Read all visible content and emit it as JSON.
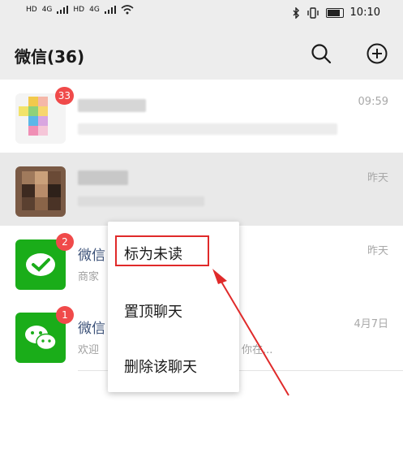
{
  "status_bar": {
    "left_icons": [
      "HD",
      "4G",
      "HD",
      "4G",
      "wifi-icon"
    ],
    "right_icons": [
      "bluetooth-icon",
      "vibrate-icon",
      "battery-icon"
    ],
    "time": "10:10"
  },
  "header": {
    "title": "微信(36)",
    "search_icon": "search-icon",
    "add_icon": "plus-circle-icon"
  },
  "chats": [
    {
      "name": "",
      "preview": "",
      "time": "09:59",
      "badge": "33"
    },
    {
      "name": "",
      "preview": "",
      "time": "昨天",
      "badge": ""
    },
    {
      "name": "微信",
      "preview": "商家",
      "time": "昨天",
      "badge": "2"
    },
    {
      "name": "微信",
      "preview": "欢迎",
      "preview_tail": "你在...",
      "time": "4月7日",
      "badge": "1"
    }
  ],
  "context_menu": {
    "items": [
      "标为未读",
      "置顶聊天",
      "删除该聊天"
    ]
  },
  "colors": {
    "header_bg": "#ededed",
    "badge": "#f04a4a",
    "wechat_green": "#1aad19",
    "highlight": "#e02a2a"
  }
}
